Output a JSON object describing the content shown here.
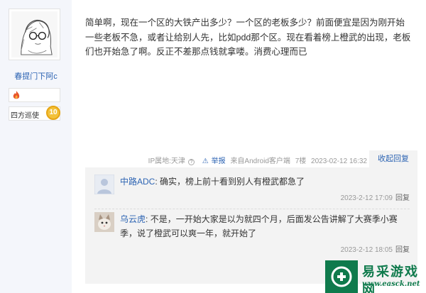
{
  "author": {
    "username": "春提门下阿c",
    "level_name": "四方巡使",
    "level": "10"
  },
  "post": {
    "content": "简单啊，现在一个区的大铁产出多少？一个区的老板多少？前面便宜是因为刚开始一些老板不急，或者让给别人先，比如pdd那个区。现在看着榜上橙武的出现，老板们也开始急了啊。反正不差那点钱就拿喽。消费心理而已",
    "ip_location": "IP属地:天津",
    "report": "举报",
    "source": "来自Android客户端",
    "floor": "7楼",
    "time": "2023-02-12 16:32",
    "reply_tab": "收起回复"
  },
  "replies": [
    {
      "user": "中路ADC",
      "text": "确实，榜上前十看到别人有橙武都急了",
      "time": "2023-2-12 17:09",
      "reply": "回复"
    },
    {
      "user": "乌云虎",
      "text": "不是，一开始大家是以为就四个月，后面发公告讲解了大赛季小赛季，说了橙武可以爽一年，就开始了",
      "time": "2023-2-12 18:05",
      "reply": "回复"
    }
  ],
  "watermark": {
    "title": "易采游戏网",
    "url": "www.easck.net"
  },
  "colors": {
    "link": "#2d64b3",
    "sidebar_bg": "#f4f6fb",
    "reply_bg": "#f3f3f3",
    "watermark": "#0f7a4c"
  }
}
